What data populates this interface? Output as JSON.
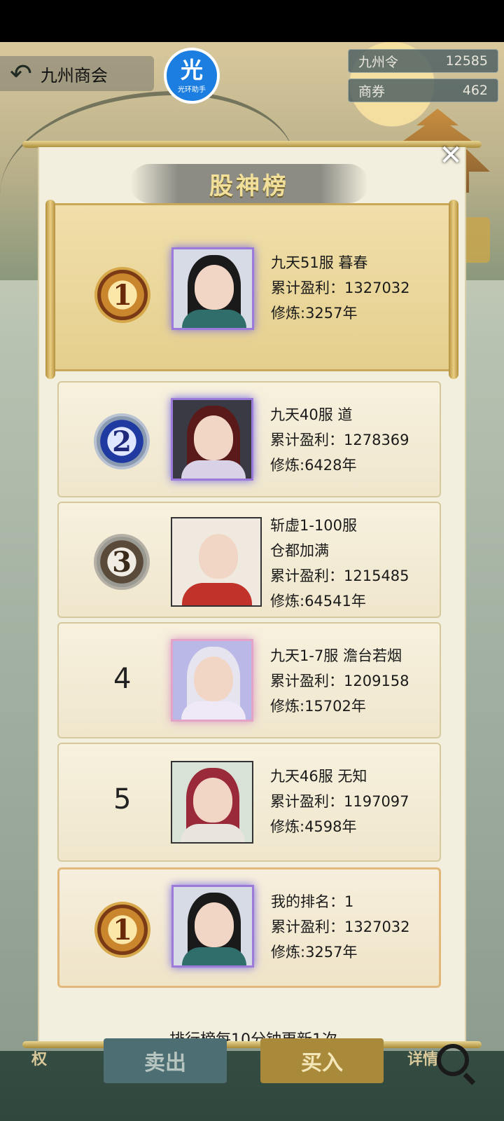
{
  "topbar": {
    "back_icon": "back-arrow-icon",
    "title": "九州商会",
    "assistant": {
      "glyph": "光",
      "label": "光环助手"
    },
    "currencies": [
      {
        "name": "九州令",
        "value": "12585"
      },
      {
        "name": "商券",
        "value": "462"
      }
    ]
  },
  "modal": {
    "title": "股神榜",
    "close_icon": "close-icon",
    "rankings": [
      {
        "rank": "1",
        "server_name": "九天51服 暮春",
        "profit": "累计盈利：1327032",
        "cultivation": "修炼:3257年"
      },
      {
        "rank": "2",
        "server_name": "九天40服 道",
        "profit": "累计盈利：1278369",
        "cultivation": "修炼:6428年"
      },
      {
        "rank": "3",
        "server_line1": "斩虚1-100服",
        "server_line2": "仓都加满",
        "profit": "累计盈利：1215485",
        "cultivation": "修炼:64541年"
      },
      {
        "rank": "4",
        "server_name": "九天1-7服 澹台若烟",
        "profit": "累计盈利：1209158",
        "cultivation": "修炼:15702年"
      },
      {
        "rank": "5",
        "server_name": "九天46服 无知",
        "profit": "累计盈利：1197097",
        "cultivation": "修炼:4598年"
      }
    ],
    "my_rank": {
      "rank": "1",
      "label": "我的排名：1",
      "profit": "累计盈利：1327032",
      "cultivation": "修炼:3257年"
    },
    "footer": "排行榜每10分钟更新1次"
  },
  "bottom": {
    "sell": "卖出",
    "buy": "买入",
    "left_icon_text": "权",
    "right_icon_text": "详情",
    "search_icon": "search-icon"
  }
}
